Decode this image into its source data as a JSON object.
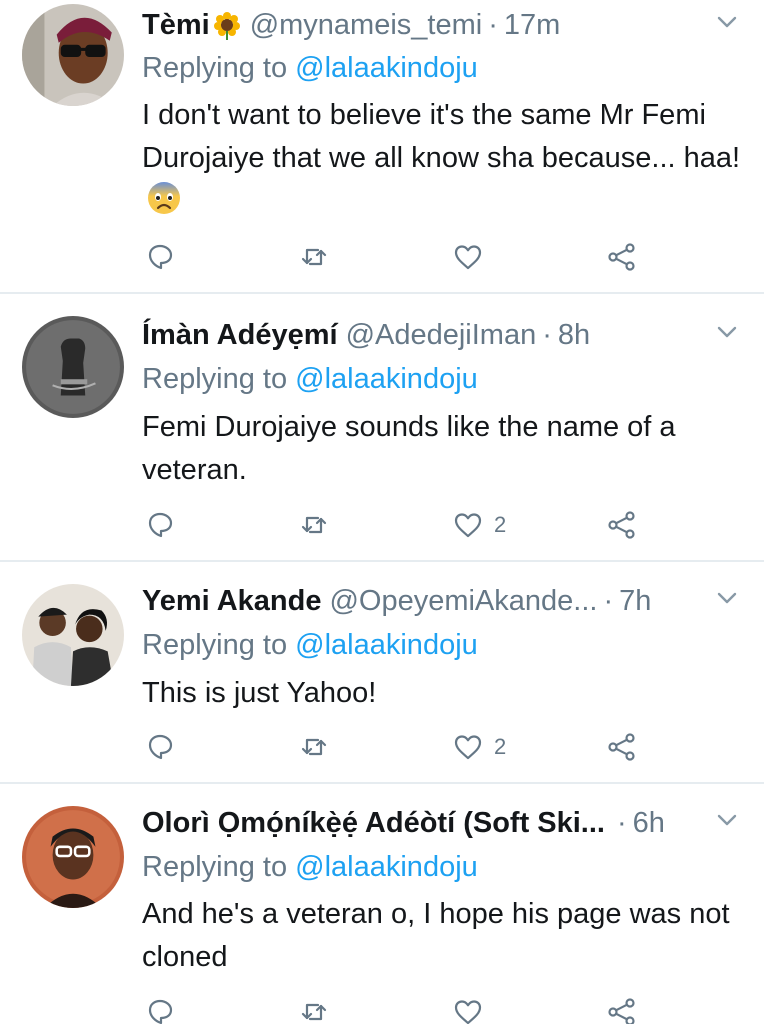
{
  "colors": {
    "accent": "#1da1f2",
    "secondary_text": "#657786",
    "primary_text": "#14171a",
    "divider": "#e6ecf0"
  },
  "icons": {
    "reply": "reply-icon",
    "retweet": "retweet-icon",
    "like": "heart-icon",
    "share": "share-icon",
    "more": "chevron-down-icon"
  },
  "tweets": [
    {
      "display_name": "Tèmi",
      "name_emoji": "sunflower-emoji",
      "handle": "@mynameis_temi",
      "separator": "·",
      "time": "17m",
      "replying_prefix": "Replying to",
      "replying_to": "@lalaakindoju",
      "text": "I don't want to believe it's the same Mr Femi Durojaiye that we all know sha because... haa!",
      "text_emoji": "fearful-face-emoji",
      "likes": ""
    },
    {
      "display_name": "Ímàn Adéyẹmí",
      "handle": "@AdedejiIman",
      "separator": "·",
      "time": "8h",
      "replying_prefix": "Replying to",
      "replying_to": "@lalaakindoju",
      "text": "Femi Durojaiye sounds like the name of a veteran.",
      "likes": "2"
    },
    {
      "display_name": "Yemi Akande",
      "handle": "@OpeyemiAkande...",
      "separator": "·",
      "time": "7h",
      "replying_prefix": "Replying to",
      "replying_to": "@lalaakindoju",
      "text": "This is just Yahoo!",
      "likes": "2"
    },
    {
      "display_name": "Olorì Ọmọ́níkẹ̀ẹ́ Adéòtí (Soft Ski...",
      "handle": "",
      "separator": "·",
      "time": "6h",
      "replying_prefix": "Replying to",
      "replying_to": "@lalaakindoju",
      "text": "And he's a veteran o, I hope his page was not cloned",
      "likes": ""
    }
  ]
}
